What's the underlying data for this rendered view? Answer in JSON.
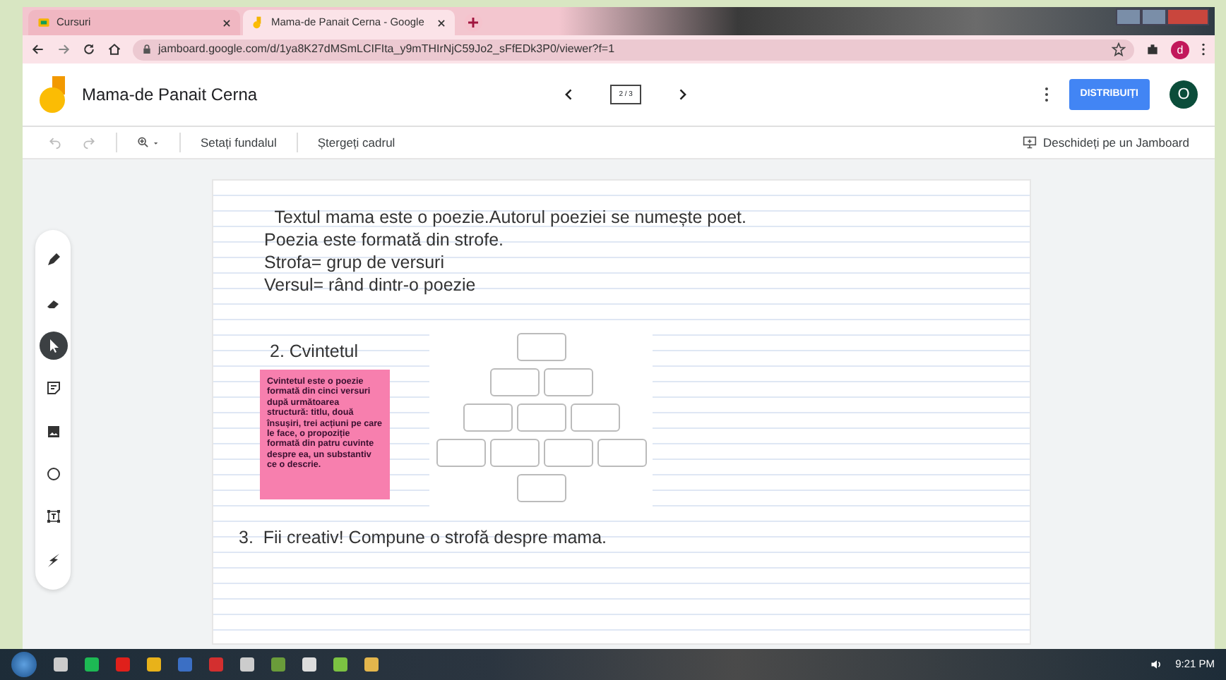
{
  "browser": {
    "tabs": [
      {
        "label": "Cursuri",
        "selected": false
      },
      {
        "label": "Mama-de Panait Cerna - Google",
        "selected": true
      }
    ],
    "url": "jamboard.google.com/d/1ya8K27dMSmLCIFIta_y9mTHIrNjC59Jo2_sFfEDk3P0/viewer?f=1",
    "profile_initial": "d"
  },
  "app": {
    "title": "Mama-de Panait Cerna",
    "frame_counter": "2 / 3",
    "share_button": "DISTRIBUIȚI",
    "account_initial": "O"
  },
  "toolbar": {
    "items": [
      "Setați fundalul",
      "Ștergeți cadrul"
    ],
    "open_button": "Deschideți pe un Jamboard"
  },
  "tools": [
    {
      "kind": "pen",
      "selected": false
    },
    {
      "kind": "eraser",
      "selected": false
    },
    {
      "kind": "select",
      "selected": true
    },
    {
      "kind": "note",
      "selected": false
    },
    {
      "kind": "image",
      "selected": false
    },
    {
      "kind": "circle",
      "selected": false
    },
    {
      "kind": "textbox",
      "selected": false
    },
    {
      "kind": "laser",
      "selected": false
    }
  ],
  "slide": {
    "intro_lines": [
      " Textul mama este o poezie.Autorul poeziei se numește poet.",
      "Poezia este formată din strofe.",
      "Strofa= grup de versuri",
      "Versul= rând dintr-o poezie"
    ],
    "section_2_heading": "2. Cvintetul",
    "sticky_note": "Cvintetul  este o poezie formată din cinci versuri după următoarea structură: titlu, două însușiri, trei acțiuni pe care le face, o propoziție formată din patru cuvinte despre ea, un substantiv ce o descrie.",
    "section_3_heading": "3.  Fii creativ! Compune o strofă despre mama."
  },
  "taskbar": {
    "time": "9:21 PM"
  }
}
